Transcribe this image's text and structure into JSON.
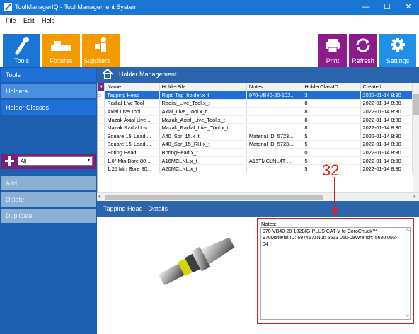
{
  "window": {
    "title": "ToolManagerIQ - Tool Management System",
    "controls": {
      "minimize": "—",
      "maximize": "☐",
      "close": "✕"
    }
  },
  "menu": [
    "File",
    "Edit",
    "Help"
  ],
  "toolbar": {
    "left": [
      {
        "label": "Tools",
        "icon": "tools-icon",
        "color": "#1976d2"
      },
      {
        "label": "Fixtures",
        "icon": "fixtures-icon",
        "color": "#f59b00"
      },
      {
        "label": "Suppliers",
        "icon": "suppliers-icon",
        "color": "#f59b00"
      }
    ],
    "right": [
      {
        "label": "Print",
        "icon": "printer-icon",
        "color": "#8e1b8c"
      },
      {
        "label": "Refresh",
        "icon": "refresh-icon",
        "color": "#8e1b8c"
      },
      {
        "label": "Settings",
        "icon": "gear-icon",
        "color": "#1e90e8"
      }
    ]
  },
  "sidebar": {
    "nav": [
      {
        "label": "Tools",
        "selected": false
      },
      {
        "label": "Holders",
        "selected": true
      },
      {
        "label": "Holder Classes",
        "selected": false
      }
    ],
    "filter_value": "All",
    "actions": [
      "Add",
      "Delete",
      "Duplicate"
    ]
  },
  "holder_management": {
    "title": "Holder Management",
    "columns": [
      "Name",
      "HolderFile",
      "Notes",
      "HolderClassID",
      "Created"
    ],
    "rows": [
      [
        "Tapping Head",
        "Rigid Tap_holder.x_t",
        "970-VB40-20-102...",
        "3",
        "2022-01-14 8:30 ."
      ],
      [
        "Radial Live Tool",
        "Radial_Live_Tool.x_t",
        "",
        "8",
        "2022-01-14 8:30 ."
      ],
      [
        "Axial Live Tool",
        "Axial_Live_Tool.x_t",
        "",
        "8",
        "2022-01-14 8:30 ."
      ],
      [
        "Mazak Axial Live ...",
        "Mazak_Axial_Live_Tool.x_t",
        "",
        "8",
        "2022-01-14 8:30 ."
      ],
      [
        "Mazak Radial Liv...",
        "Mazak_Radial_Live_Tool.x_t",
        "",
        "8",
        "2022-01-14 8:30 ."
      ],
      [
        "Square 15' Lead ...",
        "A40_Sqr_15.x_t",
        "Material ID: 5723...",
        "5",
        "2022-01-14 8:30 ."
      ],
      [
        "Square 15' Lead ...",
        "A40_Sqr_15_RH.x_t",
        "Material ID: 5723...",
        "5",
        "2022-01-14 8:30 ."
      ],
      [
        "Boring Head",
        "BoringHead.x_t",
        "",
        "0",
        "2022-01-14 8:30 ."
      ],
      [
        "1.0\" Min Bore 80...",
        "A16MCLNL.x_t",
        "A16TMCLNL4T-...",
        "5",
        "2022-01-14 8:30 ."
      ],
      [
        "1.25 Min Bore 80...",
        "A20MCLNL.x_t",
        "",
        "5",
        "2022-01-14 8:30 ."
      ]
    ],
    "selected_row": 0
  },
  "details": {
    "title": "Tapping Head - Details",
    "notes_label": "Notes:",
    "notes_text": "970-VB40-20-102BIG-PLUS CAT-V to CoroChuck™ 970Material ID: 6974171Nut: 5533 050-08Wrench: 5680 092-04"
  },
  "annotation": {
    "number": "32",
    "color": "#d32222"
  }
}
